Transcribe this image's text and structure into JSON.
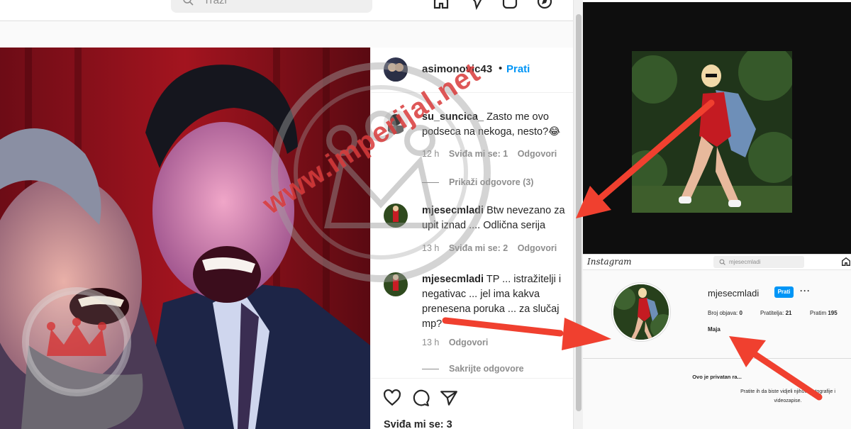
{
  "left_window": {
    "search_placeholder": "Traži",
    "post": {
      "author": "asimonovic43",
      "separator": "•",
      "follow_label": "Prati",
      "comments": [
        {
          "user": "su_suncica_",
          "text": "Zasto me ovo podseca na nekoga, nesto?😂",
          "time": "12 h",
          "likes": "Sviđa mi se: 1",
          "reply": "Odgovori",
          "thread": "Prikaži odgovore (3)"
        },
        {
          "user": "mjesecmladi",
          "text": "Btw nevezano za upit iznad .... Odlična serija",
          "time": "13 h",
          "likes": "Sviđa mi se: 2",
          "reply": "Odgovori"
        },
        {
          "user": "mjesecmladi",
          "text": "TP ... istražitelji i negativac ... jel ima kakva prenesena poruka ... za slučaj mp?",
          "time": "13 h",
          "reply": "Odgovori",
          "thread": "Sakrijte odgovore"
        }
      ],
      "likes_label": "Sviđa mi se: 3"
    }
  },
  "right_profile": {
    "logo": "Instagram",
    "search_value": "mjesecmladi",
    "username": "mjesecmladi",
    "follow_label": "Prati",
    "more": "···",
    "stats": {
      "posts_label": "Broj objava:",
      "posts_value": "0",
      "followers_label": "Pratitelja:",
      "followers_value": "21",
      "following_label": "Pratim",
      "following_value": "195"
    },
    "name": "Maja",
    "private_title": "Ovo je privatan ra...",
    "private_sub": "Pratite ih da biste vidjeli njihove fotografije i videozapise."
  },
  "watermark": {
    "text": "www.imperijal.net"
  },
  "colors": {
    "accent": "#0095f6",
    "arrow": "#f0402f",
    "watermark": "#d62d2d"
  }
}
